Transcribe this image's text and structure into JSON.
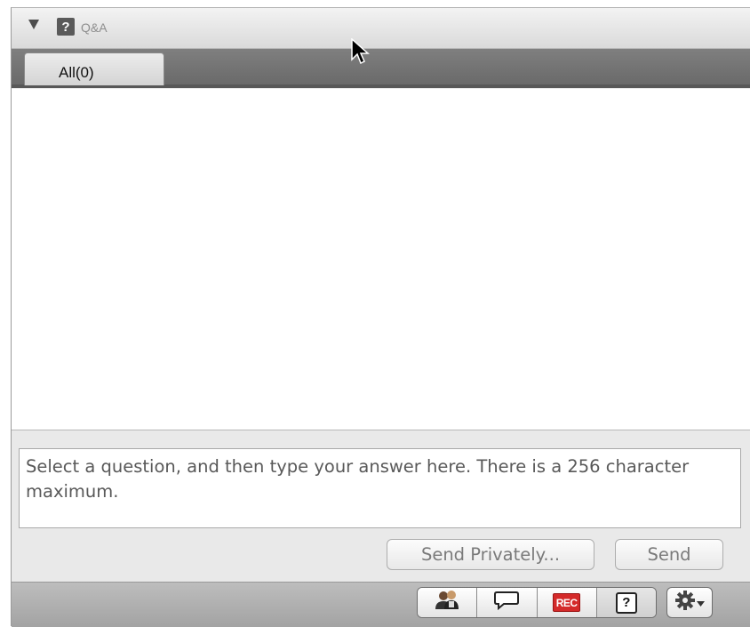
{
  "header": {
    "title": "Q&A",
    "badge_glyph": "?",
    "icons": {
      "collapse": "collapse-triangle-icon",
      "badge": "question-badge-icon"
    }
  },
  "tabs": [
    {
      "label": "All(0)",
      "selected": true
    }
  ],
  "answer": {
    "placeholder": "Select a question, and then type your answer here. There is a 256 character maximum.",
    "value": ""
  },
  "buttons": {
    "send_privately": "Send Privately...",
    "send": "Send"
  },
  "toolbar": {
    "tools": [
      {
        "name": "participants-icon"
      },
      {
        "name": "chat-icon"
      },
      {
        "name": "record-icon",
        "label": "REC"
      },
      {
        "name": "qa-icon",
        "label": "?"
      }
    ],
    "settings": {
      "name": "gear-icon"
    }
  },
  "colors": {
    "record": "#d42a2a",
    "tab_bar": "#6f6f6f",
    "panel": "#e9e9e9"
  }
}
